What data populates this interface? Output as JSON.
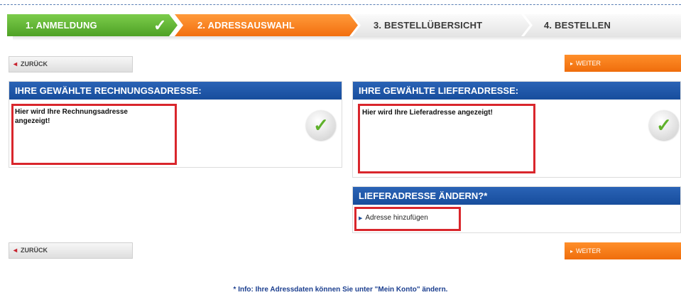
{
  "steps": [
    {
      "label": "1. ANMELDUNG",
      "state": "done"
    },
    {
      "label": "2. ADRESSAUSWAHL",
      "state": "active"
    },
    {
      "label": "3. BESTELLÜBERSICHT",
      "state": "pending"
    },
    {
      "label": "4. BESTELLEN",
      "state": "pending"
    }
  ],
  "nav": {
    "back_label": "ZURÜCK",
    "next_label": "WEITER"
  },
  "billing": {
    "title": "IHRE GEWÄHLTE RECHNUNGSADRESSE:",
    "text": "Hier wird Ihre Rechnungsadresse angezeigt!"
  },
  "shipping": {
    "title": "IHRE GEWÄHLTE LIEFERADRESSE:",
    "text": "Hier wird Ihre Lieferadresse angezeigt!"
  },
  "change": {
    "title": "LIEFERADRESSE ÄNDERN?*",
    "add_label": "Adresse hinzufügen"
  },
  "info": "* Info: Ihre Adressdaten können Sie unter \"Mein Konto\" ändern.",
  "colors": {
    "step_done": "#5fb12b",
    "step_active": "#f47a1a",
    "panel_header": "#1f56a6",
    "highlight": "#d9262c"
  }
}
